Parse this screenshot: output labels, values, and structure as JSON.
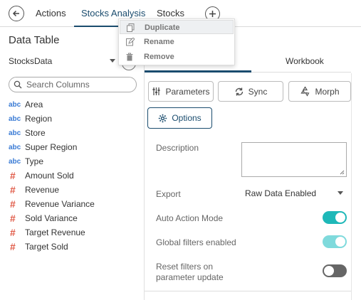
{
  "header": {
    "tabs": [
      {
        "label": "Actions"
      },
      {
        "label": "Stocks Analysis"
      },
      {
        "label": "Stocks"
      }
    ]
  },
  "context_menu": {
    "items": [
      {
        "label": "Duplicate",
        "icon": "copy-icon"
      },
      {
        "label": "Rename",
        "icon": "edit-icon"
      },
      {
        "label": "Remove",
        "icon": "trash-icon"
      }
    ]
  },
  "data_table": {
    "title": "Data Table",
    "datasource": "StocksData",
    "search_placeholder": "Search Columns",
    "columns": [
      {
        "type": "abc",
        "name": "Area"
      },
      {
        "type": "abc",
        "name": "Region"
      },
      {
        "type": "abc",
        "name": "Store"
      },
      {
        "type": "abc",
        "name": "Super Region"
      },
      {
        "type": "abc",
        "name": "Type"
      },
      {
        "type": "#",
        "name": "Amount Sold"
      },
      {
        "type": "#",
        "name": "Revenue"
      },
      {
        "type": "#",
        "name": "Revenue Variance"
      },
      {
        "type": "#",
        "name": "Sold Variance"
      },
      {
        "type": "#",
        "name": "Target Revenue"
      },
      {
        "type": "#",
        "name": "Target Sold"
      }
    ]
  },
  "workbook": {
    "tab_label": "Workbook",
    "buttons": {
      "parameters": "Parameters",
      "sync": "Sync",
      "morph": "Morph",
      "options": "Options"
    },
    "description_label": "Description",
    "export_label": "Export",
    "export_value": "Raw Data Enabled",
    "auto_action_label": "Auto Action Mode",
    "global_filters_label": "Global filters enabled",
    "reset_filters_label_1": "Reset filters on",
    "reset_filters_label_2": "parameter update",
    "auto_action_on": true,
    "global_filters_on": true,
    "reset_filters_on": false
  },
  "colors": {
    "accent": "#1a4c6e",
    "toggle_on": "#1eb8b8",
    "text_type": "#3a7bd5",
    "numeric_type": "#e05a47"
  }
}
